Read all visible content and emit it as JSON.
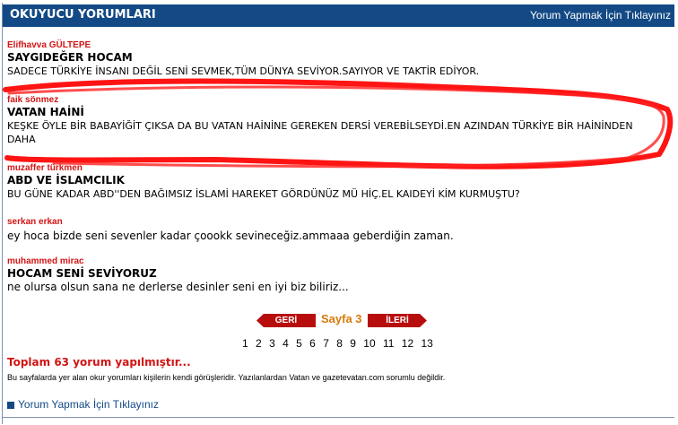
{
  "header": {
    "title": "OKUYUCU YORUMLARI",
    "link": "Yorum Yapmak İçin Tıklayınız"
  },
  "comments": [
    {
      "author": "Elifhavva GÜLTEPE",
      "title": "SAYGIDEĞER HOCAM",
      "text": "SADECE TÜRKİYE İNSANI DEĞİL SENİ SEVMEK,TÜM DÜNYA SEVİYOR.SAYIYOR VE TAKTİR EDİYOR."
    },
    {
      "author": "faik sönmez",
      "title": "VATAN HAİNİ",
      "text": "KEŞKE ÖYLE BİR BABAYİĞİT ÇIKSA DA BU VATAN HAİNİNE GEREKEN DERSİ VEREBİLSEYDİ.EN AZINDAN TÜRKİYE BİR HAİNİNDEN DAHA"
    },
    {
      "author": "muzaffer türkmen",
      "title": "ABD VE İSLAMCILIK",
      "text": "BU GÜNE KADAR ABD''DEN BAĞIMSIZ İSLAMİ HAREKET GÖRDÜNÜZ MÜ HİÇ.EL KAIDEYİ KİM KURMUŞTU?"
    },
    {
      "author": "serkan erkan",
      "title": "",
      "text": "ey hoca bizde seni sevenler kadar çoookk sevineceğiz.ammaaa geberdiğin zaman."
    },
    {
      "author": "muhammed mirac",
      "title": "HOCAM SENİ SEVİYORUZ",
      "text": "ne olursa olsun sana ne derlerse desinler seni en iyi biz biliriz..."
    }
  ],
  "pager": {
    "prev": "GERİ",
    "current": "Sayfa 3",
    "next": "İLERİ",
    "pages": [
      "1",
      "2",
      "3",
      "4",
      "5",
      "6",
      "7",
      "8",
      "9",
      "10",
      "11",
      "12",
      "13"
    ]
  },
  "footer": {
    "total": "Toplam 63 yorum yapılmıştır...",
    "disclaimer": "Bu sayfalarda yer alan okur yorumları kişilerin kendi görüşleridir. Yazılanlardan Vatan ve gazetevatan.com sorumlu değildir.",
    "link": "Yorum Yapmak İçin Tıklayınız"
  },
  "colors": {
    "header_bg": "#134a85",
    "author": "#d21414",
    "pager_button": "#b80d0d",
    "page_label": "#d87a0a",
    "scribble": "#ff0000"
  }
}
